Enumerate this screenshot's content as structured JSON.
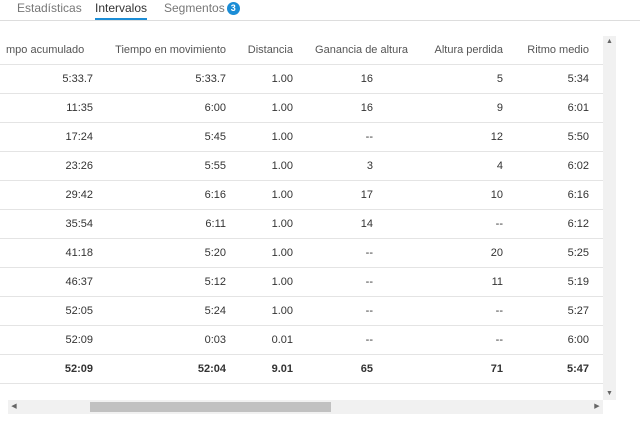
{
  "tabs": [
    {
      "label": "Estadísticas",
      "active": false
    },
    {
      "label": "Intervalos",
      "active": true
    },
    {
      "label": "Segmentos",
      "active": false,
      "badge": "3"
    }
  ],
  "table": {
    "columns": [
      "mpo acumulado",
      "Tiempo en movimiento",
      "Distancia",
      "Ganancia de altura",
      "Altura perdida",
      "Ritmo medio"
    ],
    "rows": [
      [
        "5:33.7",
        "5:33.7",
        "1.00",
        "16",
        "5",
        "5:34"
      ],
      [
        "11:35",
        "6:00",
        "1.00",
        "16",
        "9",
        "6:01"
      ],
      [
        "17:24",
        "5:45",
        "1.00",
        "--",
        "12",
        "5:50"
      ],
      [
        "23:26",
        "5:55",
        "1.00",
        "3",
        "4",
        "6:02"
      ],
      [
        "29:42",
        "6:16",
        "1.00",
        "17",
        "10",
        "6:16"
      ],
      [
        "35:54",
        "6:11",
        "1.00",
        "14",
        "--",
        "6:12"
      ],
      [
        "41:18",
        "5:20",
        "1.00",
        "--",
        "20",
        "5:25"
      ],
      [
        "46:37",
        "5:12",
        "1.00",
        "--",
        "11",
        "5:19"
      ],
      [
        "52:05",
        "5:24",
        "1.00",
        "--",
        "--",
        "5:27"
      ],
      [
        "52:09",
        "0:03",
        "0.01",
        "--",
        "--",
        "6:00"
      ]
    ],
    "total": [
      "52:09",
      "52:04",
      "9.01",
      "65",
      "71",
      "5:47"
    ]
  },
  "scrollbars": {
    "up": "▲",
    "down": "▼",
    "left": "◀",
    "right": "▶"
  },
  "colors": {
    "accent": "#1b8dd6"
  }
}
